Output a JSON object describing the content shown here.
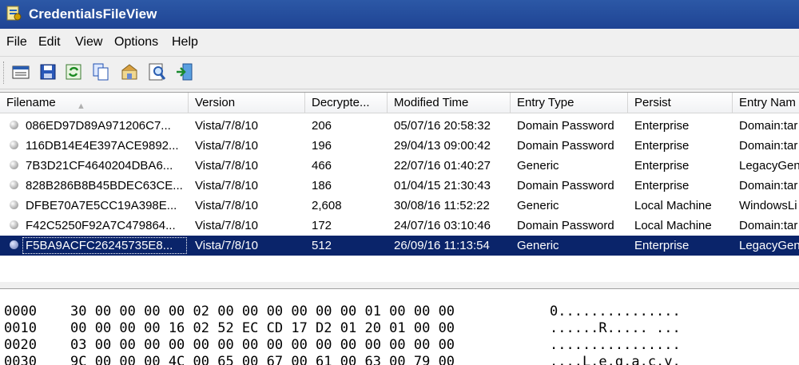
{
  "window": {
    "title": "CredentialsFileView"
  },
  "menu": [
    "File",
    "Edit",
    "View",
    "Options",
    "Help"
  ],
  "toolbar": {
    "icons": [
      "properties-icon",
      "save-icon",
      "refresh-icon",
      "copy-icon",
      "options-icon",
      "find-icon",
      "exit-icon"
    ]
  },
  "columns": [
    "Filename",
    "Version",
    "Decrypte...",
    "Modified Time",
    "Entry Type",
    "Persist",
    "Entry Nam"
  ],
  "rows": [
    {
      "filename": "086ED97D89A971206C7...",
      "version": "Vista/7/8/10",
      "size": "206",
      "modified": "05/07/16 20:58:32",
      "entry_type": "Domain Password",
      "persist": "Enterprise",
      "entry_name": "Domain:tar"
    },
    {
      "filename": "116DB14E4E397ACE9892...",
      "version": "Vista/7/8/10",
      "size": "196",
      "modified": "29/04/13 09:00:42",
      "entry_type": "Domain Password",
      "persist": "Enterprise",
      "entry_name": "Domain:tar"
    },
    {
      "filename": "7B3D21CF4640204DBA6...",
      "version": "Vista/7/8/10",
      "size": "466",
      "modified": "22/07/16 01:40:27",
      "entry_type": "Generic",
      "persist": "Enterprise",
      "entry_name": "LegacyGen"
    },
    {
      "filename": "828B286B8B45BDEC63CE...",
      "version": "Vista/7/8/10",
      "size": "186",
      "modified": "01/04/15 21:30:43",
      "entry_type": "Domain Password",
      "persist": "Enterprise",
      "entry_name": "Domain:tar"
    },
    {
      "filename": "DFBE70A7E5CC19A398E...",
      "version": "Vista/7/8/10",
      "size": "2,608",
      "modified": "30/08/16 11:52:22",
      "entry_type": "Generic",
      "persist": "Local Machine",
      "entry_name": "WindowsLi"
    },
    {
      "filename": "F42C5250F92A7C479864...",
      "version": "Vista/7/8/10",
      "size": "172",
      "modified": "24/07/16 03:10:46",
      "entry_type": "Domain Password",
      "persist": "Local Machine",
      "entry_name": "Domain:tar"
    },
    {
      "filename": "F5BA9ACFC26245735E8...",
      "version": "Vista/7/8/10",
      "size": "512",
      "modified": "26/09/16 11:13:54",
      "entry_type": "Generic",
      "persist": "Enterprise",
      "entry_name": "LegacyGen"
    }
  ],
  "selected_row": 6,
  "hex": [
    {
      "offset": "0000",
      "bytes": "30 00 00 00 00 02 00 00 00 00 00 00 01 00 00 00",
      "ascii": "0..............."
    },
    {
      "offset": "0010",
      "bytes": "00 00 00 00 16 02 52 EC CD 17 D2 01 20 01 00 00",
      "ascii": "......R..... ..."
    },
    {
      "offset": "0020",
      "bytes": "03 00 00 00 00 00 00 00 00 00 00 00 00 00 00 00",
      "ascii": "................"
    },
    {
      "offset": "0030",
      "bytes": "9C 00 00 00 4C 00 65 00 67 00 61 00 63 00 79 00",
      "ascii": "....L.e.g.a.c.y."
    }
  ],
  "colors": {
    "titlebar": "#2c58a6",
    "selection": "#0a246a"
  }
}
